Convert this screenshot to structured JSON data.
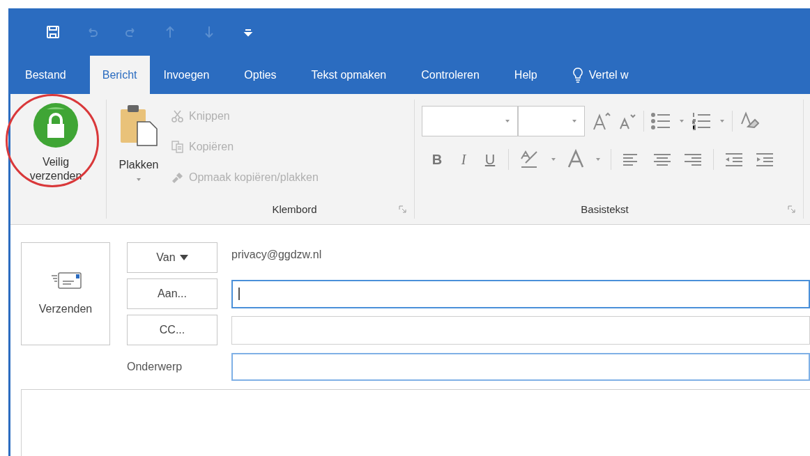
{
  "quick_access": [
    {
      "kind": "save",
      "disabled": false
    },
    {
      "kind": "undo",
      "disabled": true
    },
    {
      "kind": "redo",
      "disabled": true
    },
    {
      "kind": "up",
      "disabled": true
    },
    {
      "kind": "down",
      "disabled": true
    },
    {
      "kind": "customize",
      "disabled": false
    }
  ],
  "tabs": [
    {
      "label": "Bestand",
      "selected": false,
      "kind": "text"
    },
    {
      "label": "Bericht",
      "selected": true,
      "kind": "text"
    },
    {
      "label": "Invoegen",
      "selected": false,
      "kind": "text"
    },
    {
      "label": "Opties",
      "selected": false,
      "kind": "text"
    },
    {
      "label": "Tekst opmaken",
      "selected": false,
      "kind": "text"
    },
    {
      "label": "Controleren",
      "selected": false,
      "kind": "text"
    },
    {
      "label": "Help",
      "selected": false,
      "kind": "text"
    },
    {
      "label": "Vertel w",
      "selected": false,
      "kind": "tell"
    }
  ],
  "ribbon": {
    "secure_send": {
      "label_1": "Veilig",
      "label_2": "verzenden",
      "annotated": true
    },
    "clipboard": {
      "title": "Klembord",
      "paste": "Plakken",
      "actions": [
        {
          "label": "Knippen",
          "kind": "cut",
          "disabled": true
        },
        {
          "label": "Kopiëren",
          "kind": "copy",
          "disabled": true
        },
        {
          "label": "Opmaak kopiëren/plakken",
          "kind": "format",
          "disabled": true
        }
      ]
    },
    "basic_text": {
      "title": "Basistekst",
      "bold": "B",
      "italic": "I",
      "underline": "U"
    }
  },
  "compose": {
    "send": "Verzenden",
    "from_button": "Van",
    "from_value": "privacy@ggdzw.nl",
    "fields": [
      {
        "label": "Aan...",
        "focused": true
      },
      {
        "label": "CC...",
        "focused": false
      }
    ],
    "subject": {
      "label": "Onderwerp",
      "focused": false
    }
  }
}
